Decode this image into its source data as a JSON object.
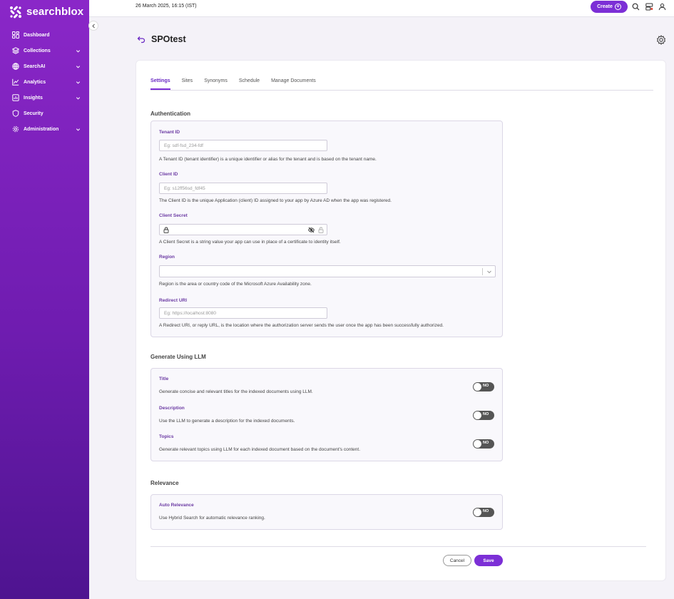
{
  "brand": {
    "name": "searchblox",
    "accent": "#7c2fd6"
  },
  "sidebar": {
    "items": [
      {
        "label": "Dashboard",
        "icon": "dashboard-icon",
        "has_chevron": false
      },
      {
        "label": "Collections",
        "icon": "layers-icon",
        "has_chevron": true
      },
      {
        "label": "SearchAI",
        "icon": "searchai-icon",
        "has_chevron": true
      },
      {
        "label": "Analytics",
        "icon": "analytics-icon",
        "has_chevron": true
      },
      {
        "label": "Insights",
        "icon": "insights-icon",
        "has_chevron": true
      },
      {
        "label": "Security",
        "icon": "shield-icon",
        "has_chevron": false
      },
      {
        "label": "Administration",
        "icon": "gear-icon",
        "has_chevron": true
      }
    ]
  },
  "topbar": {
    "datetime": "26 March 2025, 16:15 (IST)",
    "create_label": "Create",
    "icons": [
      "search-icon",
      "server-icon",
      "user-icon"
    ]
  },
  "page": {
    "title": "SPOtest"
  },
  "tabs": [
    {
      "label": "Settings",
      "active": true
    },
    {
      "label": "Sites",
      "active": false
    },
    {
      "label": "Synonyms",
      "active": false
    },
    {
      "label": "Schedule",
      "active": false
    },
    {
      "label": "Manage Documents",
      "active": false
    }
  ],
  "auth": {
    "title": "Authentication",
    "tenant": {
      "label": "Tenant ID",
      "placeholder": "Eg: sdf-fsd_234-fdf",
      "help": "A Tenant ID (tenant identifier) is a unique identifier or alias for the tenant and is based on the tenant name."
    },
    "client": {
      "label": "Client ID",
      "placeholder": "Eg: s12ff56sd_fdf45",
      "help": "The Client ID is the unique Application (client) ID assigned to your app by Azure AD when the app was registered."
    },
    "secret": {
      "label": "Client Secret",
      "help": "A Client Secret is a string value your app can use in place of a certificate to identity itself."
    },
    "region": {
      "label": "Region",
      "help": "Region is the area or country code of the Microsoft Azure Availability zone."
    },
    "redirect": {
      "label": "Redirect URI",
      "placeholder": "Eg: https://localhost:8080",
      "help": "A Redirect URI, or reply URL, is the location where the authorization server sends the user once the app has been successfully authorized."
    }
  },
  "llm": {
    "title": "Generate Using LLM",
    "title_opt": {
      "label": "Title",
      "help": "Generate concise and relevant titles for the indexed documents using LLM.",
      "state": "NO"
    },
    "description_opt": {
      "label": "Description",
      "help": "Use the LLM to generate a description for the indexed documents.",
      "state": "NO"
    },
    "topics_opt": {
      "label": "Topics",
      "help": "Generate relevant topics using LLM for each indexed document based on the document's content.",
      "state": "NO"
    }
  },
  "relevance": {
    "title": "Relevance",
    "auto": {
      "label": "Auto Relevance",
      "help": "Use Hybrid Search for automatic relevance ranking.",
      "state": "NO"
    }
  },
  "actions": {
    "cancel": "Cancel",
    "save": "Save"
  }
}
